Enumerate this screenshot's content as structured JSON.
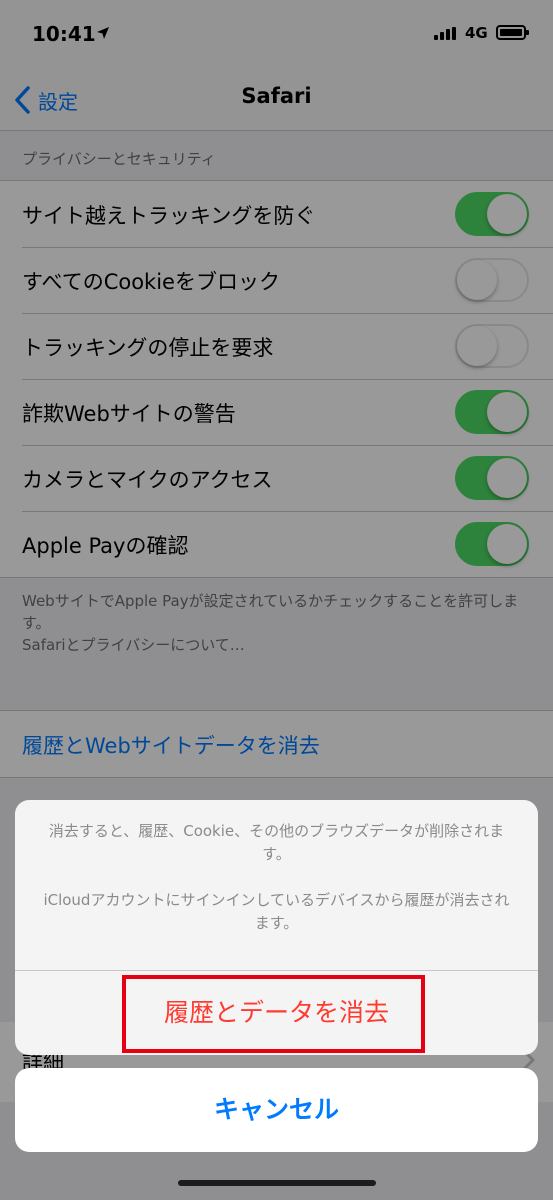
{
  "status_bar": {
    "time": "10:41",
    "location_icon": "location-arrow-icon",
    "signal_icon": "cellular-signal-icon",
    "network": "4G",
    "battery_icon": "battery-full-icon"
  },
  "nav": {
    "back_label": "設定",
    "back_icon": "chevron-left-icon",
    "title": "Safari"
  },
  "privacy_section": {
    "header": "プライバシーとセキュリティ",
    "rows": [
      {
        "label": "サイト越えトラッキングを防ぐ",
        "enabled": true
      },
      {
        "label": "すべてのCookieをブロック",
        "enabled": false
      },
      {
        "label": "トラッキングの停止を要求",
        "enabled": false
      },
      {
        "label": "詐欺Webサイトの警告",
        "enabled": true
      },
      {
        "label": "カメラとマイクのアクセス",
        "enabled": true
      },
      {
        "label": "Apple Payの確認",
        "enabled": true
      }
    ],
    "footer_line1": "WebサイトでApple Payが設定されているかチェックすることを許可します。",
    "footer_link": "Safariとプライバシーについて…"
  },
  "clear_history_label": "履歴とWebサイトデータを消去",
  "detail_label": "詳細",
  "action_sheet": {
    "message_1": "消去すると、履歴、Cookie、その他のブラウズデータが削除されます。",
    "message_2": "iCloudアカウントにサインインしているデバイスから履歴が消去されます。",
    "destructive_label": "履歴とデータを消去",
    "cancel_label": "キャンセル"
  },
  "colors": {
    "accent": "#007aff",
    "toggle_on": "#4cd964",
    "destructive": "#ff3b30",
    "highlight": "#e60012"
  }
}
